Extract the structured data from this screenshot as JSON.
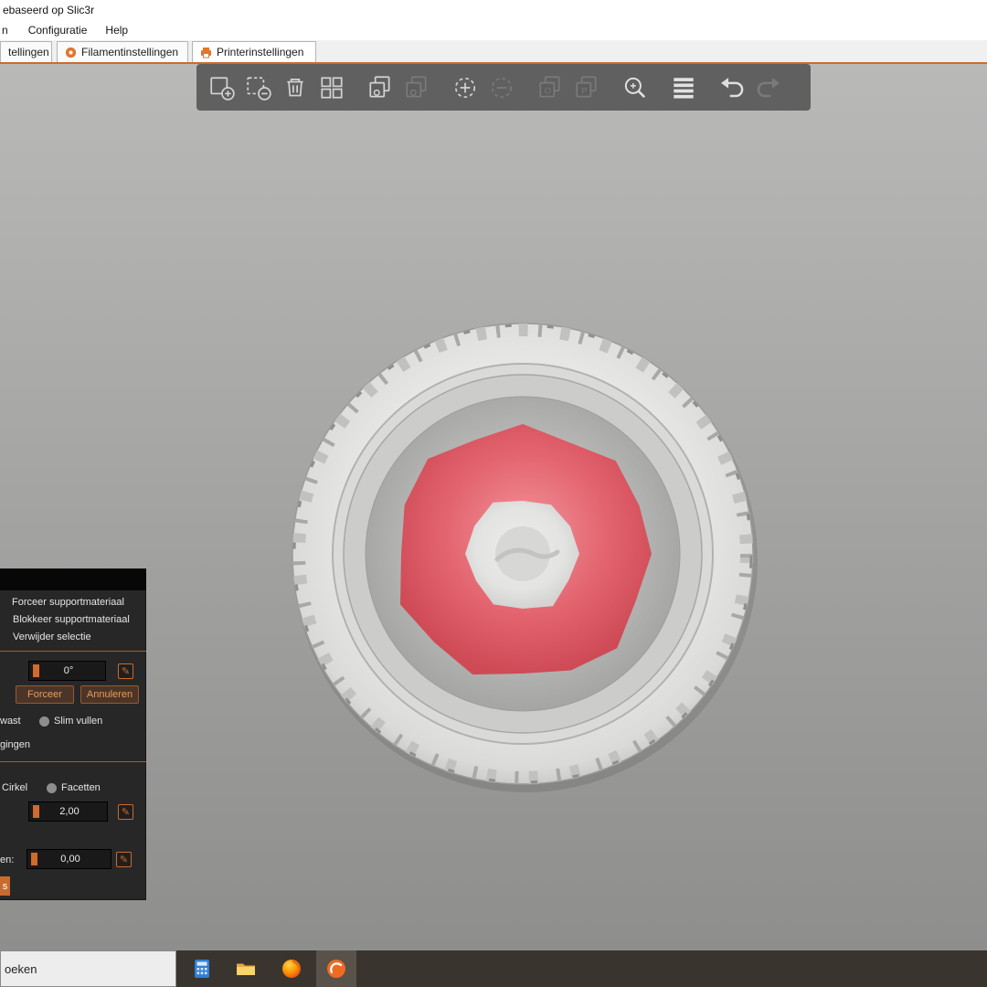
{
  "window": {
    "title": "ebaseerd op Slic3r"
  },
  "menubar": {
    "items": [
      {
        "label": "n"
      },
      {
        "label": "Configuratie"
      },
      {
        "label": "Help"
      }
    ]
  },
  "tabs": [
    {
      "label": "tellingen"
    },
    {
      "label": "Filamentinstellingen"
    },
    {
      "label": "Printerinstellingen"
    }
  ],
  "toolbar": {
    "icons": [
      {
        "name": "add-object-icon",
        "enabled": true
      },
      {
        "name": "remove-object-icon",
        "enabled": true
      },
      {
        "name": "delete-all-icon",
        "enabled": true
      },
      {
        "name": "arrange-icon",
        "enabled": true
      },
      {
        "name": "copy-icon",
        "enabled": true
      },
      {
        "name": "paste-icon",
        "enabled": false
      },
      {
        "name": "add-instance-icon",
        "enabled": true
      },
      {
        "name": "remove-instance-icon",
        "enabled": false
      },
      {
        "name": "split-to-objects-icon",
        "enabled": false
      },
      {
        "name": "split-to-parts-icon",
        "enabled": false
      },
      {
        "name": "search-icon",
        "enabled": true
      },
      {
        "name": "variable-layer-height-icon",
        "enabled": true
      },
      {
        "name": "undo-icon",
        "enabled": true
      },
      {
        "name": "redo-icon",
        "enabled": false
      }
    ]
  },
  "support_panel": {
    "menu_items": [
      "Forceer supportmateriaal",
      "Blokkeer supportmateriaal",
      "Verwijder selectie"
    ],
    "angle_value": "0°",
    "force_button": "Forceer",
    "cancel_button": "Annuleren",
    "fill_left": "wast",
    "fill_right": "Slim vullen",
    "fragment": "gingen",
    "shape_left": "Cirkel",
    "shape_right": "Facetten",
    "size_value": "2,00",
    "gap_label": "en:",
    "gap_value": "0,00",
    "bottom_button": "s"
  },
  "taskbar": {
    "search_text": "oeken",
    "apps": [
      {
        "name": "calculator-icon"
      },
      {
        "name": "file-explorer-icon"
      },
      {
        "name": "firefox-icon"
      },
      {
        "name": "prusaslicer-icon"
      }
    ]
  },
  "colors": {
    "accent": "#ED6B21",
    "separator": "#a85a2b",
    "paint_red": "#d9545f",
    "viewport_top": "#b9b9b8",
    "viewport_bottom": "#8e8e8d"
  }
}
